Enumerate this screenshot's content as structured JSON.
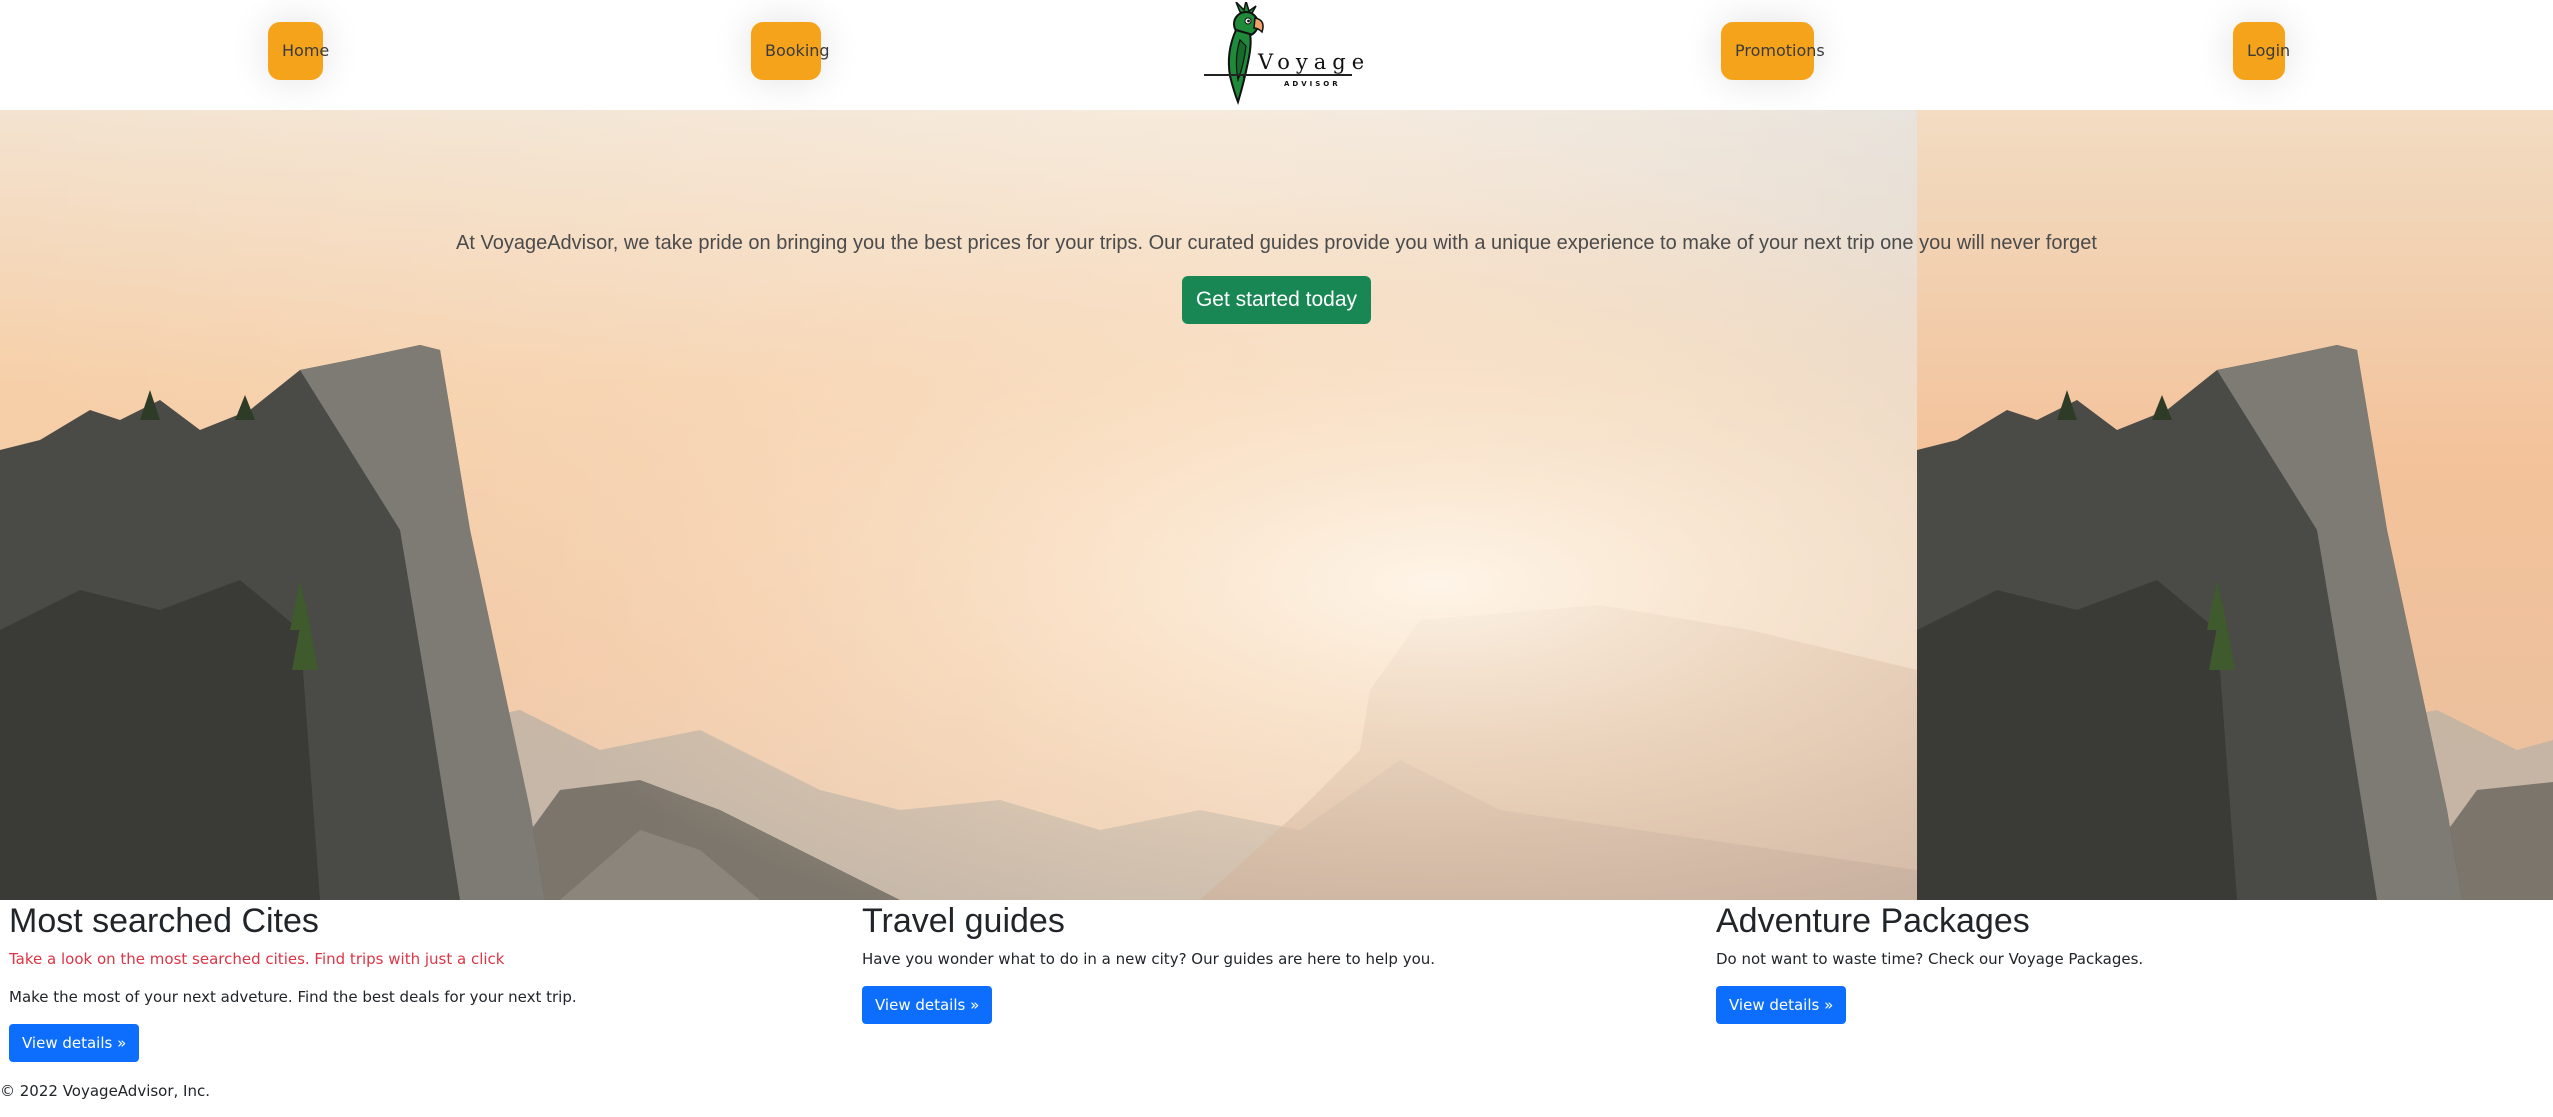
{
  "nav": {
    "home": "Home",
    "booking": "Booking",
    "promotions": "Promotions",
    "login": "Login",
    "logo_word": "Voyage",
    "logo_sub": "ADVISOR",
    "logo_icon": "parrot-logo-icon"
  },
  "hero": {
    "lead": "At VoyageAdvisor, we take pride on bringing you the best prices for your trips. Our curated guides provide you with a unique experience to make of your next trip one you will never forget",
    "cta": "Get started today"
  },
  "features": [
    {
      "title": "Most searched Cites",
      "subtitle": "Take a look on the most searched cities. Find trips with just a click",
      "body": "Make the most of your next adveture. Find the best deals for your next trip.",
      "button": "View details »"
    },
    {
      "title": "Travel guides",
      "subtitle": "Have you wonder what to do in a new city? Our guides are here to help you.",
      "button": "View details »"
    },
    {
      "title": "Adventure Packages",
      "subtitle": "Do not want to waste time? Check our Voyage Packages.",
      "button": "View details »"
    }
  ],
  "footer": {
    "copyright": "© 2022 VoyageAdvisor, Inc."
  },
  "colors": {
    "nav_button": "#f5a31a",
    "cta": "#198754",
    "details_button": "#0d6efd",
    "accent_red": "#dc3545"
  }
}
